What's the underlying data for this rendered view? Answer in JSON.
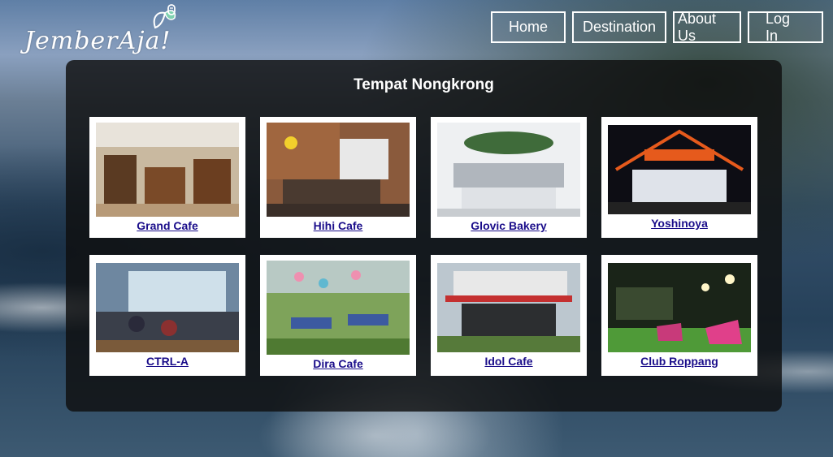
{
  "brand": {
    "logo_text": "JemberAja!"
  },
  "nav": {
    "items": [
      {
        "label": "Home"
      },
      {
        "label": "Destination"
      },
      {
        "label": "About Us"
      },
      {
        "label": "Log In"
      }
    ]
  },
  "panel": {
    "title": "Tempat Nongkrong",
    "cards": [
      {
        "name": "Grand Cafe",
        "image": "cafe-interior-photo"
      },
      {
        "name": "Hihi Cafe",
        "image": "cafe-interior-photo"
      },
      {
        "name": "Glovic Bakery",
        "image": "bakery-interior-photo"
      },
      {
        "name": "Yoshinoya",
        "image": "restaurant-storefront-photo"
      },
      {
        "name": "CTRL-A",
        "image": "cafe-interior-photo"
      },
      {
        "name": "Dira Cafe",
        "image": "garden-cafe-photo"
      },
      {
        "name": "Idol Cafe",
        "image": "cafe-exterior-photo"
      },
      {
        "name": "Club Roppang",
        "image": "outdoor-lounge-photo"
      }
    ]
  },
  "colors": {
    "link": "#1a0d8a",
    "panel": "#0f0f0f",
    "nav_border": "#ffffff"
  }
}
